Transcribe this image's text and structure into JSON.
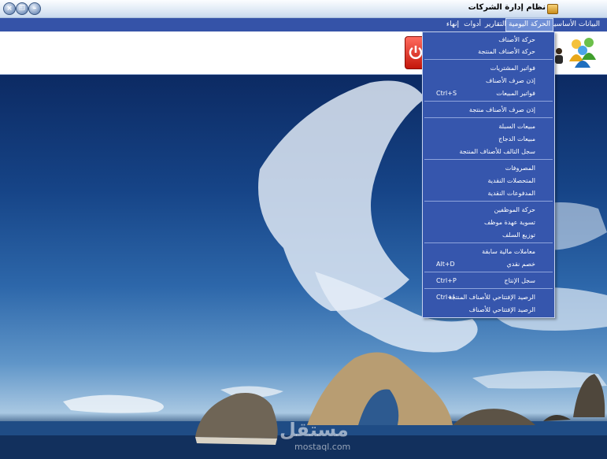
{
  "window": {
    "title": "نظام إدارة الشركات",
    "controls": {
      "close": "×",
      "restore": "❐",
      "minimize": "–"
    }
  },
  "menubar": {
    "items": [
      {
        "label": "البيانات الأساسية"
      },
      {
        "label": "الحركة اليومية",
        "active": true
      },
      {
        "label": "التقارير"
      },
      {
        "label": "أدوات"
      },
      {
        "label": "إنهاء"
      }
    ]
  },
  "toolbar": {
    "icons": [
      "users-icon",
      "person-icon",
      "power-icon"
    ]
  },
  "dropdown": {
    "items": [
      {
        "label": "حركة الأصناف",
        "shortcut": ""
      },
      {
        "label": "حركة الأصناف المنتجة",
        "shortcut": ""
      },
      {
        "label": "فواتير المشتريات",
        "shortcut": ""
      },
      {
        "label": "إذن صرف الأصناف",
        "shortcut": ""
      },
      {
        "label": "فواتير المبيعات",
        "shortcut": "Ctrl+S"
      },
      {
        "label": "إذن صرف الأصناف منتجة",
        "shortcut": ""
      },
      {
        "label": "مبيعات السبلة",
        "shortcut": ""
      },
      {
        "label": "مبيعات الدجاج",
        "shortcut": ""
      },
      {
        "label": "سجل التالف للأصناف المنتجة",
        "shortcut": ""
      },
      {
        "label": "المصروفات",
        "shortcut": ""
      },
      {
        "label": "المتحصلات النقدية",
        "shortcut": ""
      },
      {
        "label": "المدفوعات النقدية",
        "shortcut": ""
      },
      {
        "label": "حركة الموظفين",
        "shortcut": ""
      },
      {
        "label": "تسوية عهدة موظف",
        "shortcut": ""
      },
      {
        "label": "توزيع السلف",
        "shortcut": ""
      },
      {
        "label": "معاملات مالية سابقة",
        "shortcut": ""
      },
      {
        "label": "خصم نقدي",
        "shortcut": "Alt+D"
      },
      {
        "label": "سجل الإنتاج",
        "shortcut": "Ctrl+P"
      },
      {
        "label": "الرصيد الإفتتاحي للأصناف المنتجة",
        "shortcut": "Ctrl+I"
      },
      {
        "label": "الرصيد الإفتتاحي للأصناف",
        "shortcut": ""
      }
    ]
  },
  "watermark": {
    "text": "مستقل",
    "sub": "mostaql.com"
  },
  "colors": {
    "menubar": "#3553a8",
    "dropdown": "#3656ad",
    "accent": "#6f8fd6"
  }
}
